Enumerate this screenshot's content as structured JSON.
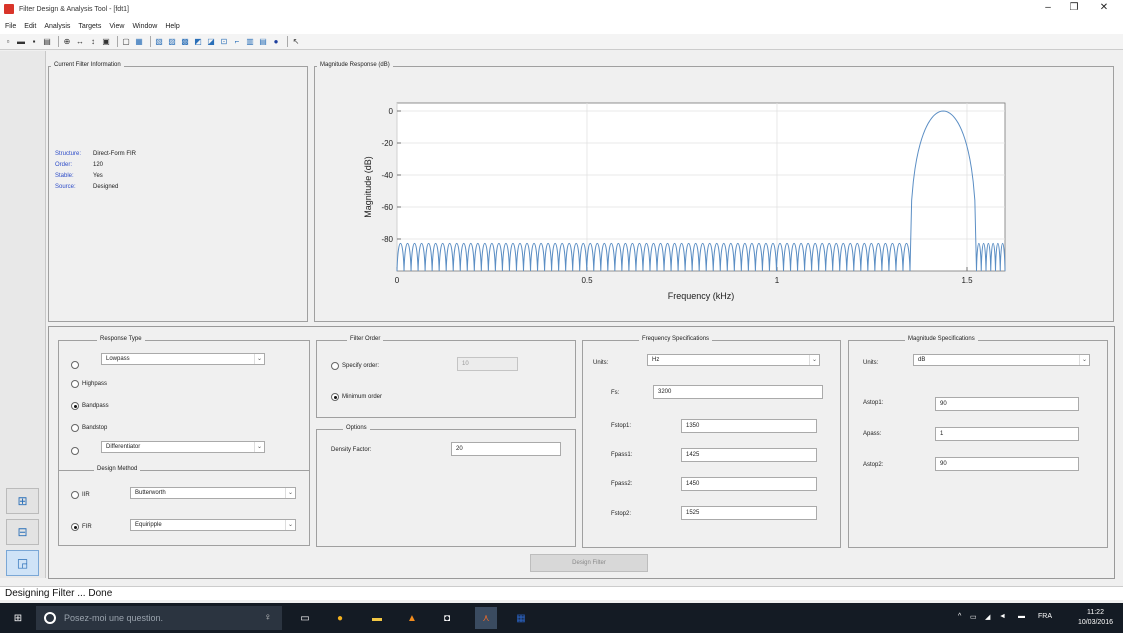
{
  "window": {
    "title": "Filter Design & Analysis Tool - [fdt1]",
    "controls": [
      "–",
      "❐",
      "✕"
    ]
  },
  "menu": [
    "File",
    "Edit",
    "Analysis",
    "Targets",
    "View",
    "Window",
    "Help"
  ],
  "current_filter_info": {
    "title": "Current Filter Information",
    "rows": [
      {
        "key": "Structure:",
        "value": "Direct-Form FIR"
      },
      {
        "key": "Order:",
        "value": "120"
      },
      {
        "key": "Stable:",
        "value": "Yes"
      },
      {
        "key": "Source:",
        "value": "Designed"
      }
    ]
  },
  "magnitude_panel_title": "Magnitude Response (dB)",
  "chart_data": {
    "type": "line",
    "title": "",
    "xlabel": "Frequency (kHz)",
    "ylabel": "Magnitude (dB)",
    "xlim": [
      0,
      1.6
    ],
    "ylim": [
      -100,
      5
    ],
    "x_ticks": [
      "0",
      "0.5",
      "1",
      "1.5"
    ],
    "y_ticks": [
      "0",
      "-20",
      "-40",
      "-60",
      "-80"
    ],
    "grid": true,
    "series": [
      {
        "stopband_level_db": -90,
        "stopband_ripple_peak_db": -80,
        "stopband_lobe_count_lower": 73,
        "stopband_lobe_count_upper": 6,
        "stopband1_end_khz": 1.35,
        "stopband2_start_khz": 1.525,
        "passband_center_khz": 1.4375,
        "passband_peak_db": 0,
        "color": "#5b8ec4"
      }
    ]
  },
  "response_type": {
    "title": "Response Type",
    "options": [
      {
        "label": "Lowpass",
        "selected": false,
        "has_dropdown": true
      },
      {
        "label": "Highpass",
        "selected": false
      },
      {
        "label": "Bandpass",
        "selected": true
      },
      {
        "label": "Bandstop",
        "selected": false
      },
      {
        "label": "Differentiator",
        "selected": false,
        "has_dropdown": true
      }
    ]
  },
  "design_method": {
    "title": "Design Method",
    "options": [
      {
        "label": "IIR",
        "selected": false,
        "dropdown": "Butterworth"
      },
      {
        "label": "FIR",
        "selected": true,
        "dropdown": "Equiripple"
      }
    ]
  },
  "filter_order": {
    "title": "Filter Order",
    "specify_label": "Specify order:",
    "specify_value": "10",
    "minimum_label": "Minimum order",
    "minimum_selected": true
  },
  "options": {
    "title": "Options",
    "density_label": "Density Factor:",
    "density_value": "20"
  },
  "frequency_specs": {
    "title": "Frequency Specifications",
    "units_label": "Units:",
    "units_value": "Hz",
    "fs_label": "Fs:",
    "fs_value": "3200",
    "fields": [
      {
        "label": "Fstop1:",
        "value": "1350"
      },
      {
        "label": "Fpass1:",
        "value": "1425"
      },
      {
        "label": "Fpass2:",
        "value": "1450"
      },
      {
        "label": "Fstop2:",
        "value": "1525"
      }
    ]
  },
  "magnitude_specs": {
    "title": "Magnitude Specifications",
    "units_label": "Units:",
    "units_value": "dB",
    "fields": [
      {
        "label": "Astop1:",
        "value": "90"
      },
      {
        "label": "Apass:",
        "value": "1"
      },
      {
        "label": "Astop2:",
        "value": "90"
      }
    ]
  },
  "design_button": "Design Filter",
  "status": "Designing Filter ... Done",
  "taskbar": {
    "search_placeholder": "Posez-moi une question.",
    "language": "FRA",
    "time": "11:22",
    "date": "10/03/2016"
  }
}
